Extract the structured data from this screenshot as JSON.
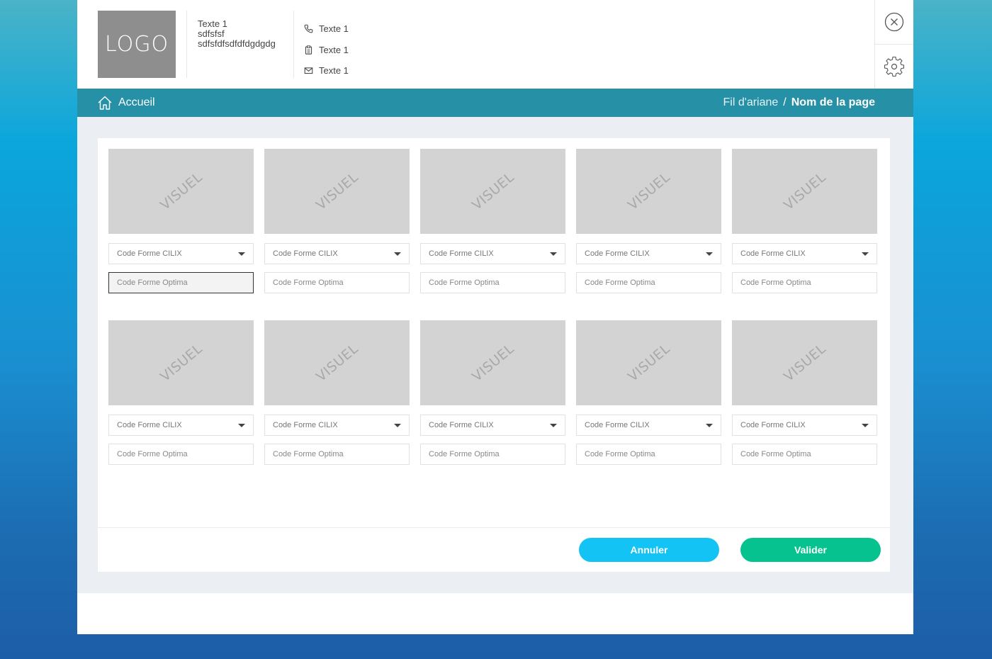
{
  "header": {
    "logo_text": "LOGO",
    "info_lines": [
      "Texte 1",
      "sdfsfsf",
      "sdfsfdfsdfdfdgdgdg"
    ],
    "contacts": [
      {
        "icon": "phone-icon",
        "text": "Texte 1"
      },
      {
        "icon": "clipboard-icon",
        "text": "Texte 1"
      },
      {
        "icon": "mail-icon",
        "text": "Texte 1"
      }
    ],
    "actions": [
      "close-icon",
      "gear-icon"
    ]
  },
  "nav": {
    "home_label": "Accueil",
    "breadcrumb_link": "Fil d'ariane",
    "breadcrumb_separator": "/",
    "breadcrumb_current": "Nom de la page"
  },
  "grid": {
    "visual_label": "VISUEL",
    "select_label": "Code Forme CILIX",
    "input_placeholder": "Code Forme Optima",
    "rows": 2,
    "columns": 5,
    "focused_input_index": 0
  },
  "buttons": {
    "cancel": "Annuler",
    "validate": "Valider"
  },
  "colors": {
    "navbar": "#2690a6",
    "cancel": "#12c3f3",
    "validate": "#06c28e",
    "visual_placeholder": "#d3d3d3"
  }
}
